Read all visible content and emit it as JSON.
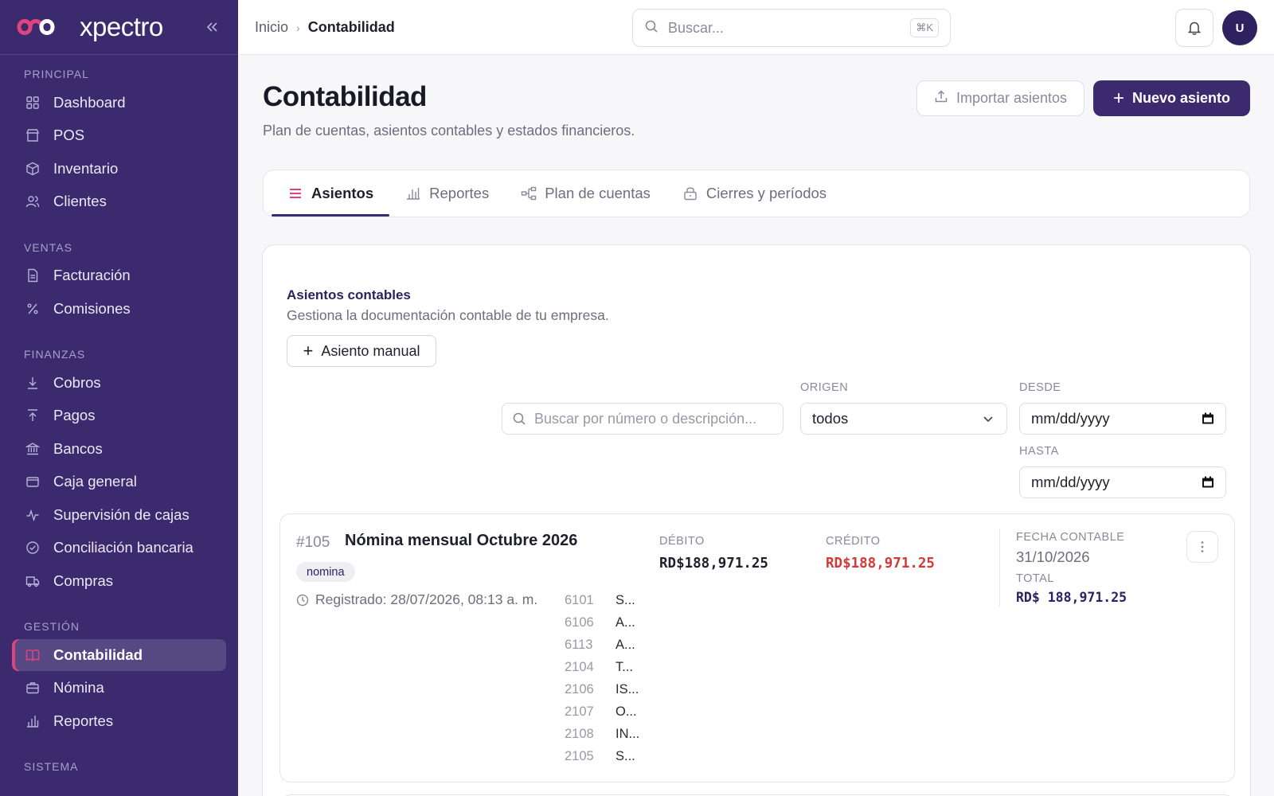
{
  "brand": {
    "name": "xpectro",
    "collapse_icon": "chevrons-left-icon",
    "colors": {
      "primary": "#3b2b6e",
      "accent": "#e0447e"
    }
  },
  "sidebar": {
    "sections": [
      {
        "title": "PRINCIPAL",
        "items": [
          {
            "label": "Dashboard",
            "icon": "grid-icon"
          },
          {
            "label": "POS",
            "icon": "store-icon"
          },
          {
            "label": "Inventario",
            "icon": "box-icon"
          },
          {
            "label": "Clientes",
            "icon": "users-icon"
          }
        ]
      },
      {
        "title": "VENTAS",
        "items": [
          {
            "label": "Facturación",
            "icon": "file-icon"
          },
          {
            "label": "Comisiones",
            "icon": "percent-icon"
          }
        ]
      },
      {
        "title": "FINANZAS",
        "items": [
          {
            "label": "Cobros",
            "icon": "arrow-down-icon"
          },
          {
            "label": "Pagos",
            "icon": "arrow-up-icon"
          },
          {
            "label": "Bancos",
            "icon": "bank-icon"
          },
          {
            "label": "Caja general",
            "icon": "wallet-icon"
          },
          {
            "label": "Supervisión de cajas",
            "icon": "activity-icon"
          },
          {
            "label": "Conciliación bancaria",
            "icon": "check-circle-icon"
          },
          {
            "label": "Compras",
            "icon": "truck-icon"
          }
        ]
      },
      {
        "title": "GESTIÓN",
        "items": [
          {
            "label": "Contabilidad",
            "icon": "book-icon",
            "active": true
          },
          {
            "label": "Nómina",
            "icon": "briefcase-icon"
          },
          {
            "label": "Reportes",
            "icon": "bar-chart-icon"
          }
        ]
      },
      {
        "title": "SISTEMA",
        "items": []
      }
    ]
  },
  "topbar": {
    "breadcrumb": {
      "home": "Inicio",
      "current": "Contabilidad"
    },
    "search_placeholder": "Buscar...",
    "search_shortcut": "⌘K",
    "avatar_initial": "U"
  },
  "page": {
    "title": "Contabilidad",
    "subtitle": "Plan de cuentas, asientos contables y estados financieros.",
    "import_label": "Importar asientos",
    "new_label": "Nuevo asiento"
  },
  "tabs": [
    {
      "label": "Asientos",
      "icon": "list-icon",
      "active": true
    },
    {
      "label": "Reportes",
      "icon": "bar-chart-icon"
    },
    {
      "label": "Plan de cuentas",
      "icon": "hierarchy-icon"
    },
    {
      "label": "Cierres y períodos",
      "icon": "lock-icon"
    }
  ],
  "card": {
    "title": "Asientos contables",
    "subtitle": "Gestiona la documentación contable de tu empresa.",
    "manual_label": "Asiento manual",
    "filters": {
      "search_placeholder": "Buscar por número o descripción...",
      "origin_label": "ORIGEN",
      "origin_value": "todos",
      "from_label": "DESDE",
      "from_value": "mm/dd/yyyy",
      "to_label": "HASTA",
      "to_value": "mm/dd/yyyy"
    }
  },
  "entry": {
    "number": "#105",
    "title": "Nómina mensual Octubre 2026",
    "tag": "nomina",
    "registered": "Registrado: 28/07/2026, 08:13 a. m.",
    "debit_label": "DÉBITO",
    "debit": "RD$188,971.25",
    "credit_label": "CRÉDITO",
    "credit": "RD$188,971.25",
    "date_label": "FECHA CONTABLE",
    "date": "31/10/2026",
    "total_label": "TOTAL",
    "total": "RD$ 188,971.25",
    "lines": [
      {
        "code": "6101",
        "account": "S..."
      },
      {
        "code": "6106",
        "account": "A..."
      },
      {
        "code": "6113",
        "account": "A..."
      },
      {
        "code": "2104",
        "account": "T..."
      },
      {
        "code": "2106",
        "account": "IS..."
      },
      {
        "code": "2107",
        "account": "O..."
      },
      {
        "code": "2108",
        "account": "IN..."
      },
      {
        "code": "2105",
        "account": "S..."
      }
    ]
  }
}
